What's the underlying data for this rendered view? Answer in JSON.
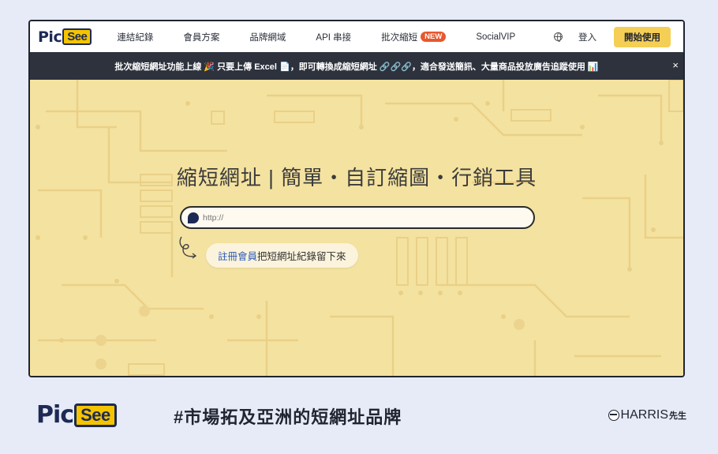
{
  "nav": {
    "logo_pic": "Pic",
    "logo_see": "See",
    "links": [
      "連結紀錄",
      "會員方案",
      "品牌網域",
      "API 串接",
      "批次縮短",
      "SocialVIP"
    ],
    "new_badge": "NEW",
    "login": "登入",
    "start": "開始使用"
  },
  "announcement": {
    "text": "批次縮短網址功能上線 🎉 只要上傳 Excel 📄，即可轉換成縮短網址 🔗🔗🔗，適合發送簡訊、大量商品投放廣告追蹤使用 📊",
    "close": "×"
  },
  "hero": {
    "headline": "縮短網址 | 簡單・自訂縮圖・行銷工具",
    "url_placeholder": "http://",
    "register_link": "註冊會員",
    "register_rest": "把短網址紀錄留下來"
  },
  "footer": {
    "logo_pic": "Pic",
    "logo_see": "See",
    "slogan": "#市場拓及亞洲的短網址品牌",
    "harris": "HARRIS",
    "harris_sub": "先生"
  },
  "colors": {
    "hero_bg": "#f4e2a0",
    "accent_yellow": "#f5cf55",
    "navy": "#1d2a55",
    "announce_bg": "#2d323d",
    "new_badge": "#e8572e"
  }
}
